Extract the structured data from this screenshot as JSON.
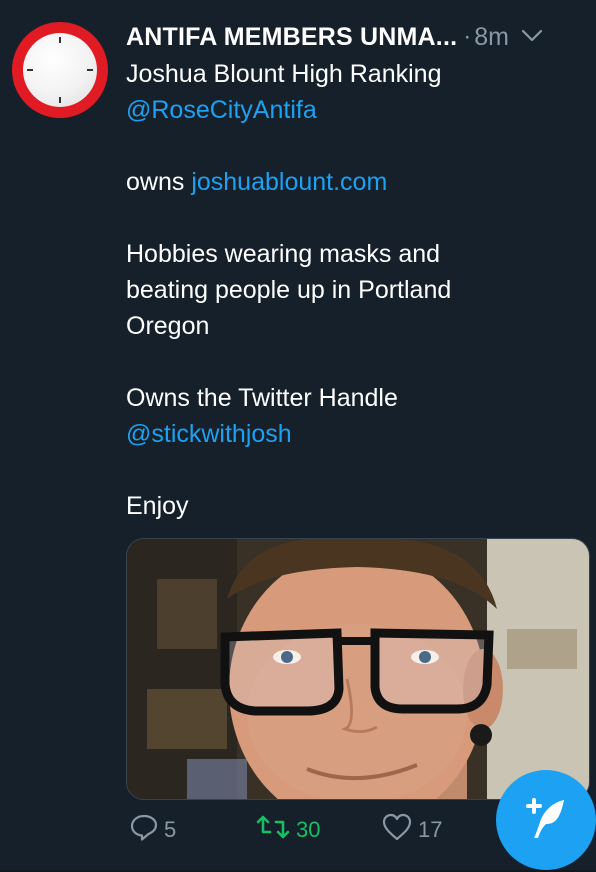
{
  "tweet": {
    "display_name": "ANTIFA MEMBERS UNMA...",
    "dot": "·",
    "timestamp": "8m",
    "text_lines": [
      {
        "text": "Joshua Blount High Ranking",
        "kind": "plain"
      },
      {
        "text": "@RoseCityAntifa",
        "kind": "link"
      },
      {
        "text": "",
        "kind": "blank"
      },
      {
        "prefix": "owns ",
        "link": "joshuablount.com",
        "kind": "mixed"
      },
      {
        "text": "",
        "kind": "blank"
      },
      {
        "text": "Hobbies wearing masks and",
        "kind": "plain"
      },
      {
        "text": "beating people up in Portland",
        "kind": "plain"
      },
      {
        "text": "Oregon",
        "kind": "plain"
      },
      {
        "text": "",
        "kind": "blank"
      },
      {
        "text": "Owns the Twitter Handle",
        "kind": "plain"
      },
      {
        "text": "@stickwithjosh",
        "kind": "link"
      },
      {
        "text": "",
        "kind": "blank"
      },
      {
        "text": "Enjoy",
        "kind": "plain"
      }
    ],
    "actions": {
      "reply_count": "5",
      "retweet_count": "30",
      "like_count": "17"
    }
  },
  "colors": {
    "background": "#15202b",
    "link": "#1da1f2",
    "secondary_text": "#8899a6",
    "retweet": "#17bf63",
    "fab": "#1da1f2",
    "avatar_ring": "#e01b24"
  },
  "icons": {
    "more": "chevron-down-icon",
    "reply": "reply-icon",
    "retweet": "retweet-icon",
    "like": "heart-icon",
    "compose": "compose-tweet-icon"
  }
}
